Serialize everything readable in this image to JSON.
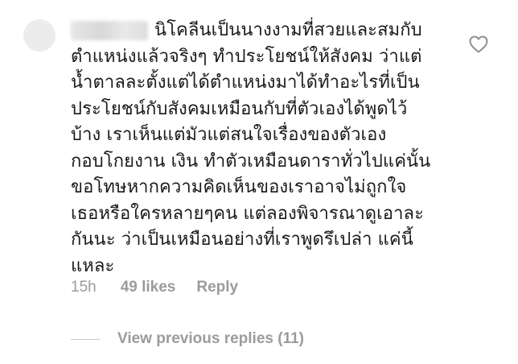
{
  "comment": {
    "username": "",
    "lines": [
      "นิโคลีนเป็นนางงามที่สวยและสมกับ",
      "ตำแหน่งแล้วจริงๆ ทำประโยชน์ให้สังคม ว่าแต่",
      "น้ำตาลละตั้งแต่ได้ตำแหน่งมาได้ทำอะไรที่เป็น",
      "ประโยชน์กับสังคมเหมือนกับที่ตัวเองได้พูดไว้",
      "บ้าง เราเห็นแต่มัวแต่สนใจเรื่องของตัวเอง",
      "กอบโกยงาน เงิน ทำตัวเหมือนดาราทั่วไปแค่นั้น",
      "ขอโทษหากความคิดเห็นของเราอาจไม่ถูกใจ",
      "เธอหรือใครหลายๆคน แต่ลองพิจารณาดูเอาละ",
      "กันนะ ว่าเป็นเหมือนอย่างที่เราพูดรึเปล่า แค่นี้",
      "แหละ"
    ],
    "time": "15h",
    "likes": "49 likes",
    "reply_label": "Reply",
    "view_replies_label": "View previous replies (11)",
    "heart_icon": "heart-outline-icon"
  }
}
